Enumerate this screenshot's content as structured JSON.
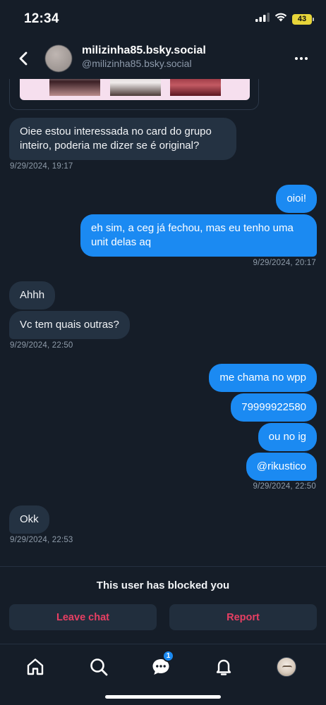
{
  "status_bar": {
    "time": "12:34",
    "battery": "43",
    "icons": [
      "signal-icon",
      "wifi-icon",
      "battery-icon"
    ]
  },
  "header": {
    "display_name": "milizinha85.bsky.social",
    "handle": "@milizinha85.bsky.social",
    "icons": [
      "back-arrow-icon",
      "more-options-icon"
    ]
  },
  "messages": [
    {
      "direction": "in",
      "text": "Oiee estou interessada no card do grupo inteiro, poderia me dizer se é original?"
    },
    {
      "direction": "in",
      "timestamp": "9/29/2024, 19:17"
    },
    {
      "direction": "out",
      "text": "oioi!"
    },
    {
      "direction": "out",
      "text": "eh sim, a ceg já fechou, mas eu tenho uma unit delas aq"
    },
    {
      "direction": "out",
      "timestamp": "9/29/2024, 20:17"
    },
    {
      "direction": "in",
      "text": "Ahhh"
    },
    {
      "direction": "in",
      "text": "Vc tem quais outras?"
    },
    {
      "direction": "in",
      "timestamp": "9/29/2024, 22:50"
    },
    {
      "direction": "out",
      "text": "me chama no wpp"
    },
    {
      "direction": "out",
      "text": "79999922580"
    },
    {
      "direction": "out",
      "text": "ou no ig"
    },
    {
      "direction": "out",
      "text": "@rikustico"
    },
    {
      "direction": "out",
      "timestamp": "9/29/2024, 22:50"
    },
    {
      "direction": "in",
      "text": "Okk"
    },
    {
      "direction": "in",
      "timestamp": "9/29/2024, 22:53"
    }
  ],
  "blocked": {
    "notice": "This user has blocked you",
    "leave_label": "Leave chat",
    "report_label": "Report"
  },
  "tabbar": {
    "tabs": [
      "home-icon",
      "search-icon",
      "chat-icon",
      "notifications-icon",
      "profile-avatar"
    ],
    "chat_badge": "1"
  },
  "colors": {
    "background": "#151d28",
    "incoming_bubble": "#243242",
    "outgoing_bubble": "#1b8af2",
    "danger_text": "#e83f63",
    "battery": "#e7d53a"
  }
}
